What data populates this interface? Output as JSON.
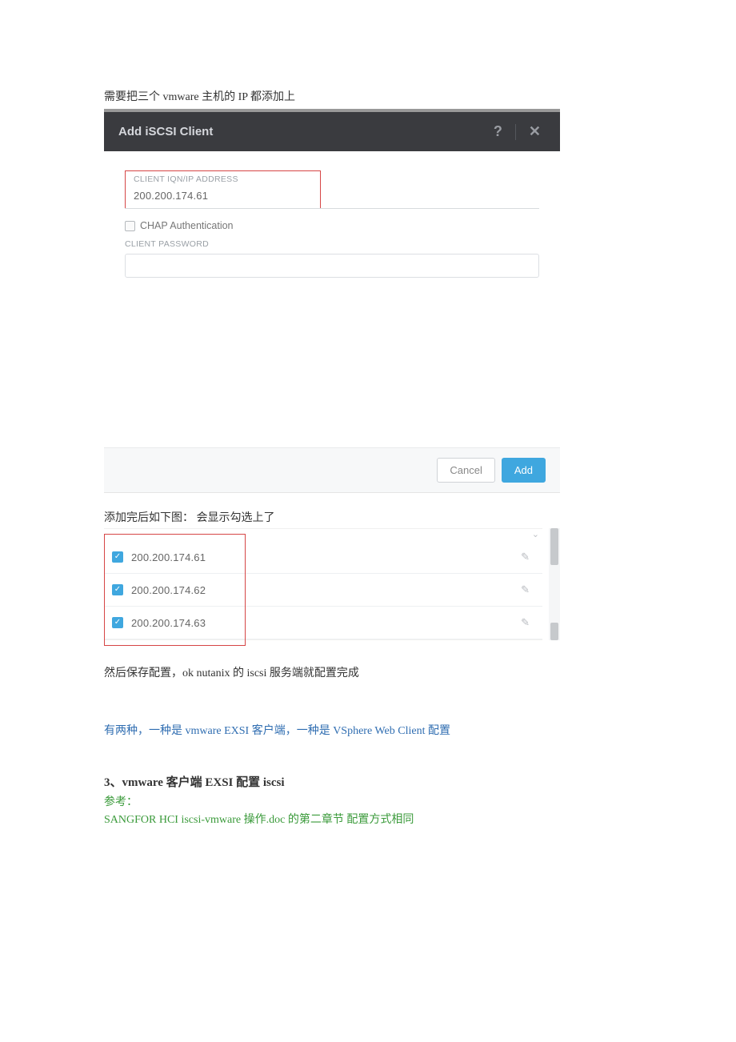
{
  "intro_text": "需要把三个 vmware 主机的 IP 都添加上",
  "dialog": {
    "title": "Add iSCSI Client",
    "help_icon": "?",
    "close_icon": "✕",
    "client_label": "CLIENT IQN/IP ADDRESS",
    "client_value": "200.200.174.61",
    "chap_label": "CHAP Authentication",
    "password_label": "CLIENT PASSWORD",
    "password_value": "",
    "cancel_label": "Cancel",
    "add_label": "Add"
  },
  "after_add_text": "添加完后如下图：  会显示勾选上了",
  "list_items": [
    {
      "ip": "200.200.174.61"
    },
    {
      "ip": "200.200.174.62"
    },
    {
      "ip": "200.200.174.63"
    }
  ],
  "fragment_top": "",
  "para1": "然后保存配置，ok nutanix 的 iscsi 服务端就配置完成",
  "para2": "有两种，一种是 vmware EXSI 客户端，一种是 VSphere Web Client 配置",
  "heading": "3、vmware 客户端 EXSI 配置 iscsi",
  "ref_label": "参考：",
  "ref_doc": "SANGFOR HCI iscsi-vmware 操作.doc  的第二章节  配置方式相同"
}
